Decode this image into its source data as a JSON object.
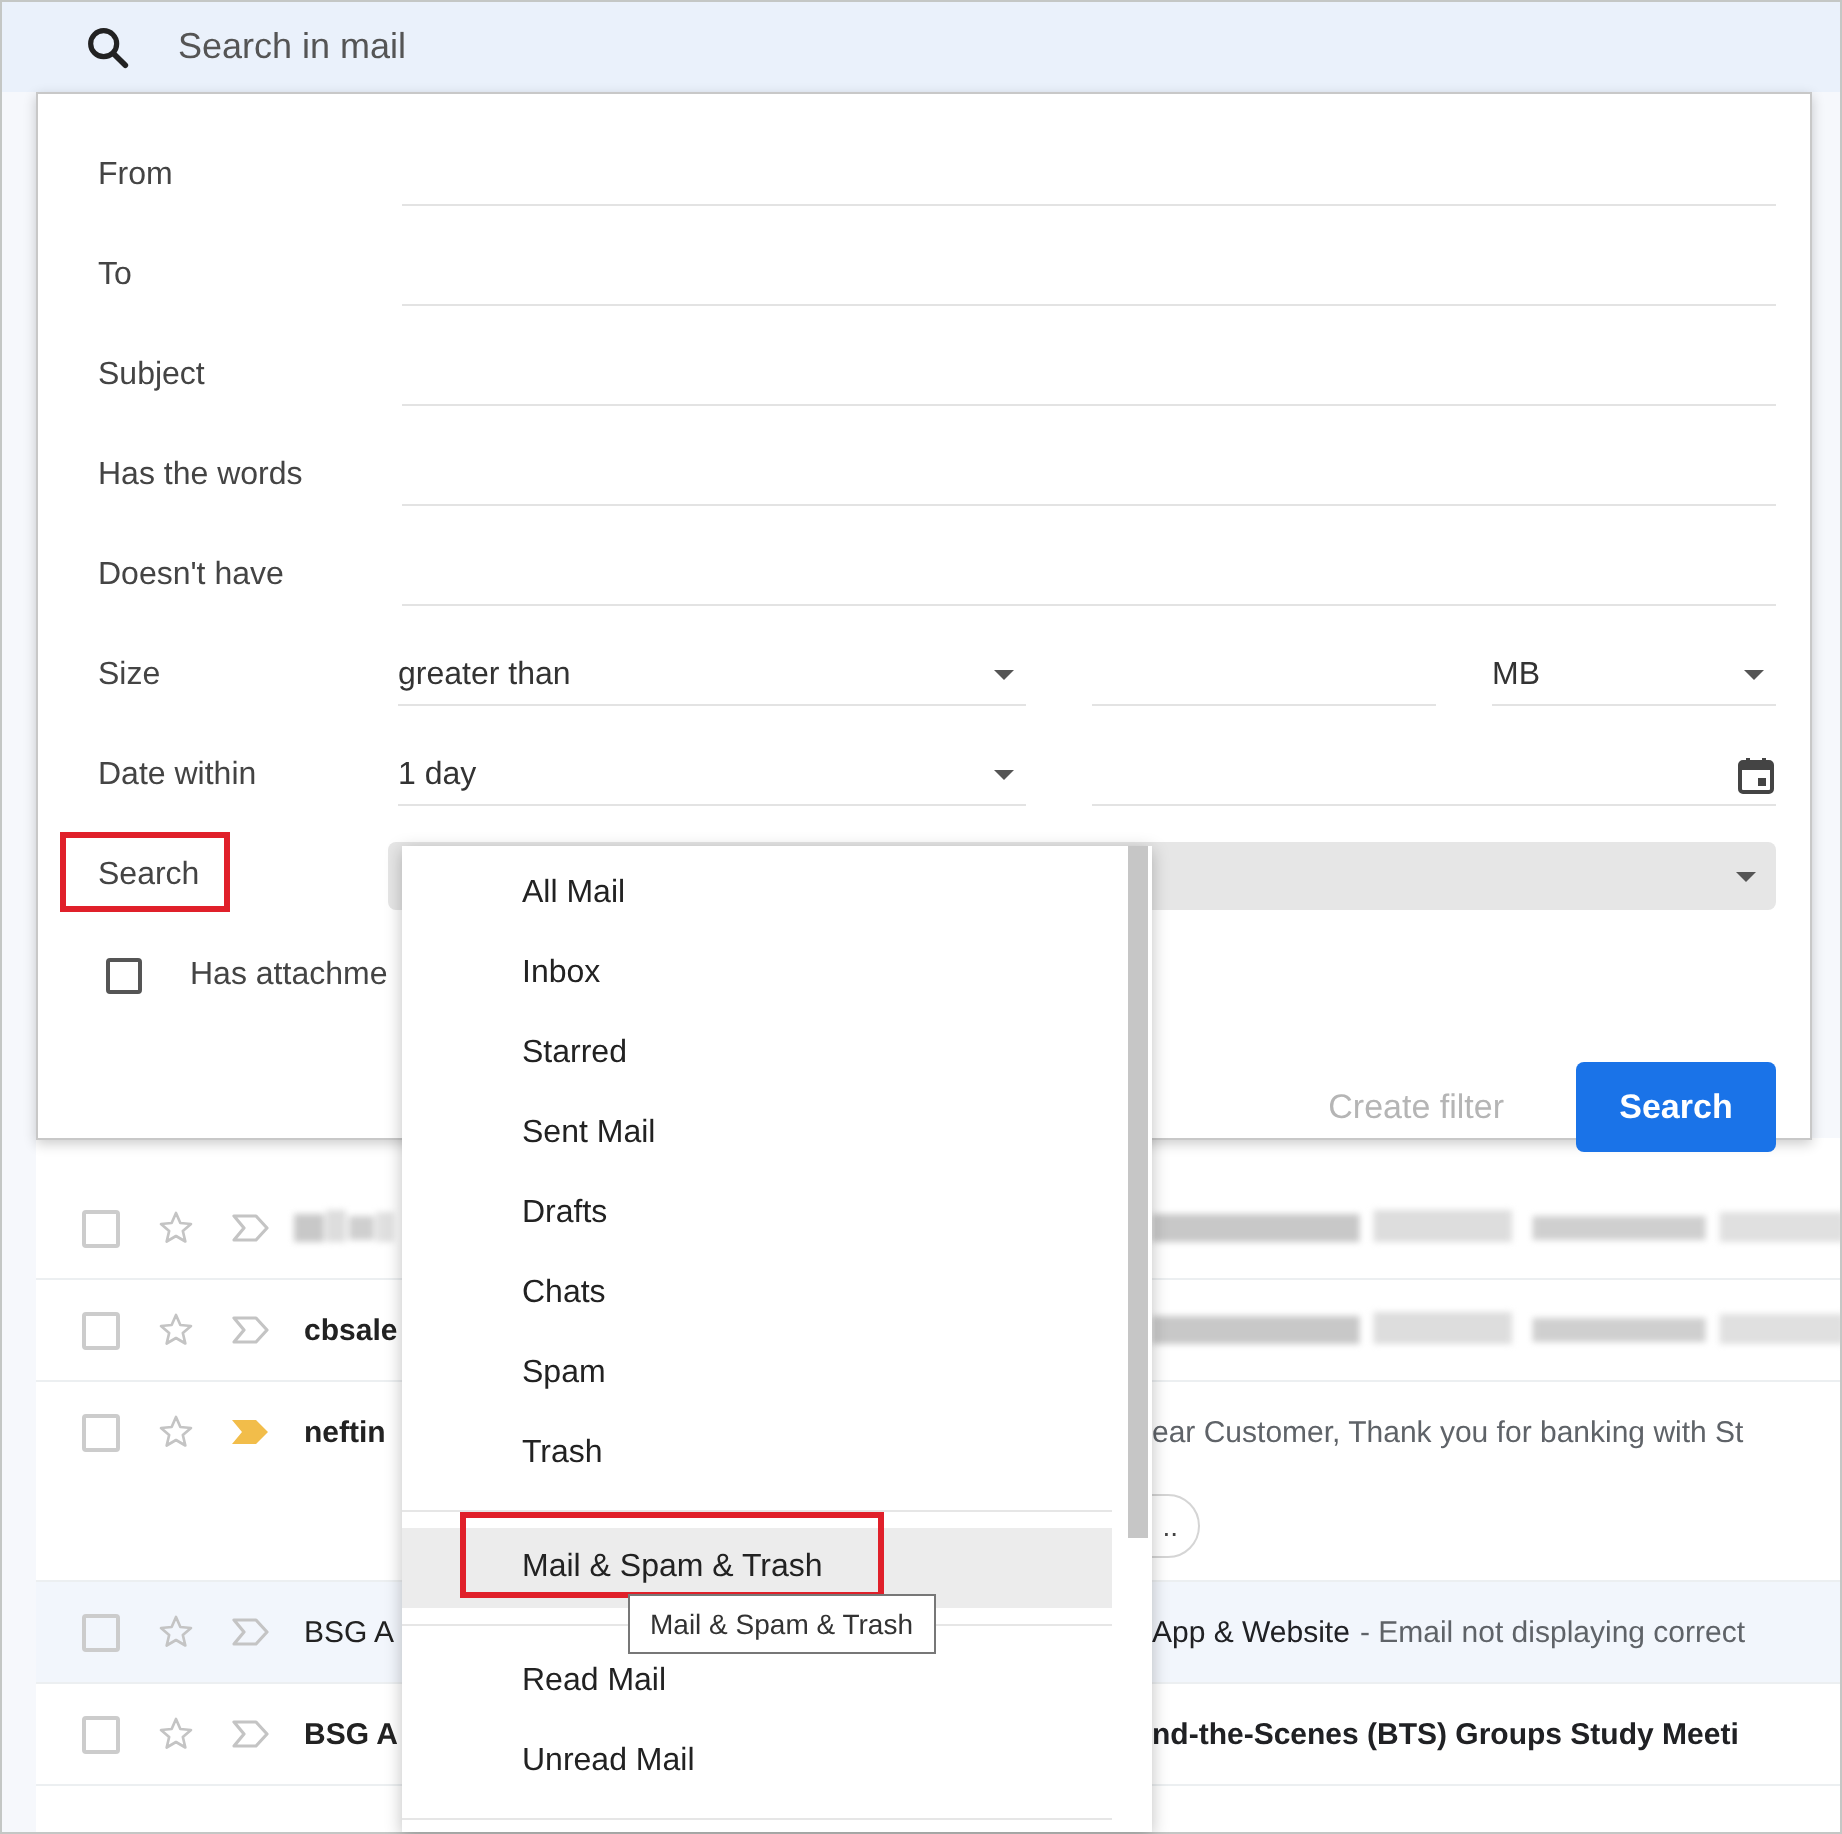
{
  "search_bar": {
    "placeholder": "Search in mail"
  },
  "form": {
    "text_fields": [
      {
        "label": "From"
      },
      {
        "label": "To"
      },
      {
        "label": "Subject"
      },
      {
        "label": "Has the words"
      },
      {
        "label": "Doesn't have"
      }
    ],
    "size": {
      "label": "Size",
      "operator": "greater than",
      "unit": "MB"
    },
    "date_within": {
      "label": "Date within",
      "value": "1 day"
    },
    "search_in": {
      "label": "Search",
      "annotated": true
    },
    "attachment": {
      "label": "Has attachme",
      "checked": false
    },
    "buttons": [
      {
        "label": "Create filter",
        "kind": "text",
        "disabled": true
      },
      {
        "label": "Search",
        "kind": "primary",
        "disabled": false
      }
    ]
  },
  "emails": [
    {
      "sender_redacted": true,
      "subject_redacted": true,
      "read": false,
      "important": false
    },
    {
      "sender": "cbsale",
      "subject_redacted": true,
      "read": false,
      "important": false
    },
    {
      "sender": "neftin",
      "snippet": "ear Customer, Thank you for banking with St",
      "chip": "..",
      "read": false,
      "important": true
    },
    {
      "sender": "BSG A",
      "subject": "App & Website",
      "snippet": "- Email not displaying correct",
      "read": true,
      "important": false
    },
    {
      "sender": "BSG A",
      "subject": "nd-the-Scenes (BTS) Groups Study Meeti",
      "read": false,
      "important": false
    }
  ],
  "dropdown": {
    "options": [
      {
        "label": "All Mail",
        "highlighted": false,
        "annotated": false,
        "divider_before": false
      },
      {
        "label": "Inbox",
        "highlighted": false,
        "annotated": false,
        "divider_before": false
      },
      {
        "label": "Starred",
        "highlighted": false,
        "annotated": false,
        "divider_before": false
      },
      {
        "label": "Sent Mail",
        "highlighted": false,
        "annotated": false,
        "divider_before": false
      },
      {
        "label": "Drafts",
        "highlighted": false,
        "annotated": false,
        "divider_before": false
      },
      {
        "label": "Chats",
        "highlighted": false,
        "annotated": false,
        "divider_before": false
      },
      {
        "label": "Spam",
        "highlighted": false,
        "annotated": false,
        "divider_before": false
      },
      {
        "label": "Trash",
        "highlighted": false,
        "annotated": false,
        "divider_before": false
      },
      {
        "label": "Mail & Spam & Trash",
        "highlighted": true,
        "annotated": true,
        "divider_before": true
      },
      {
        "label": "Read Mail",
        "highlighted": false,
        "annotated": false,
        "divider_before": true
      },
      {
        "label": "Unread Mail",
        "highlighted": false,
        "annotated": false,
        "divider_before": false
      }
    ],
    "tooltip": "Mail & Spam & Trash"
  }
}
